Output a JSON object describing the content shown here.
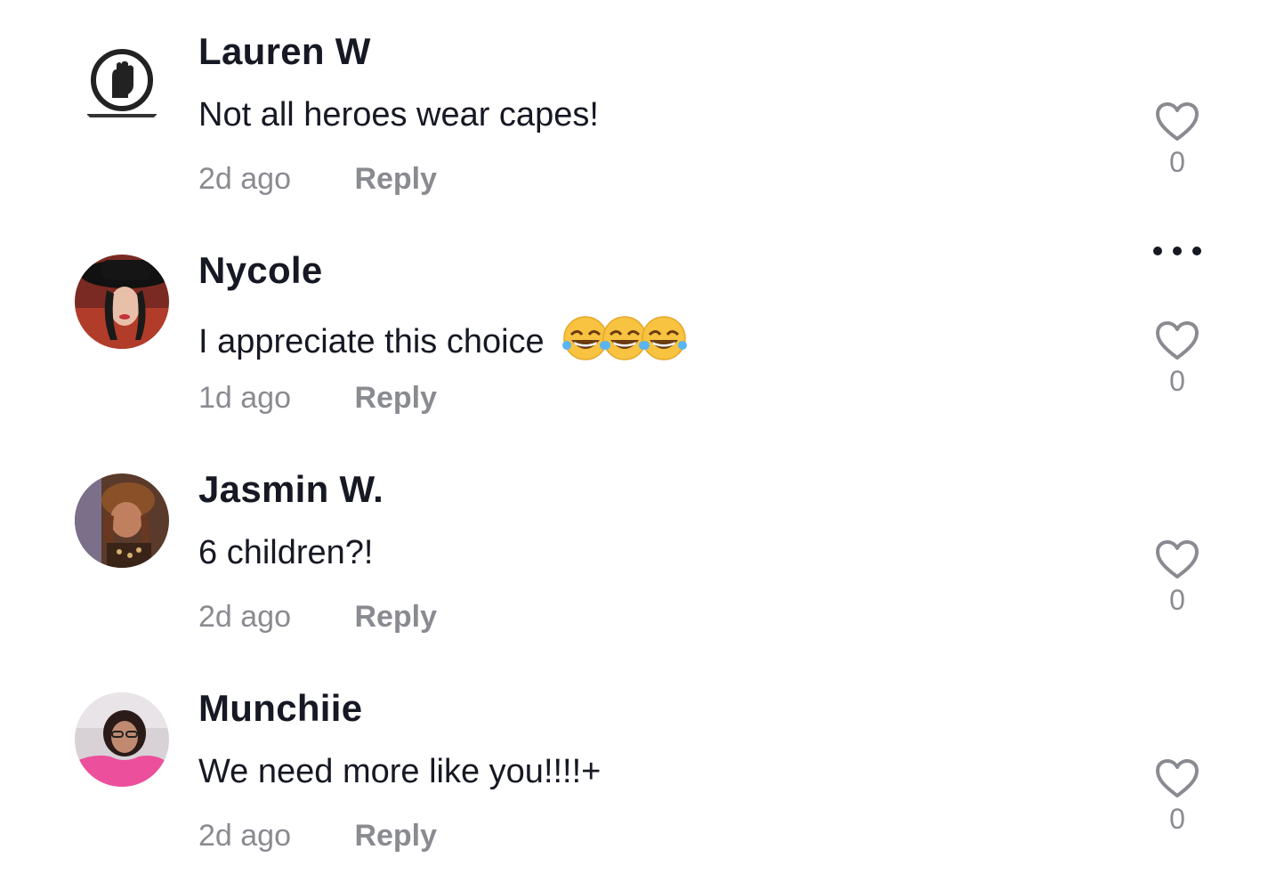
{
  "comments": [
    {
      "username": "Lauren W",
      "text": "Not all heroes wear capes!",
      "time": "2d ago",
      "reply_label": "Reply",
      "likes": "0",
      "avatar": "fist-logo-avatar",
      "emoji": ""
    },
    {
      "username": "Nycole",
      "text": "I appreciate this choice",
      "time": "1d ago",
      "reply_label": "Reply",
      "likes": "0",
      "avatar": "photo-avatar",
      "emoji": "😂😂😂"
    },
    {
      "username": "Jasmin W.",
      "text": "6 children?!",
      "time": "2d ago",
      "reply_label": "Reply",
      "likes": "0",
      "avatar": "photo-avatar",
      "emoji": ""
    },
    {
      "username": "Munchiie",
      "text": "We need more like you!!!!+",
      "time": "2d ago",
      "reply_label": "Reply",
      "likes": "0",
      "avatar": "photo-avatar",
      "emoji": ""
    }
  ],
  "icons": {
    "like": "heart-outline-icon",
    "more": "more-options-icon"
  },
  "colors": {
    "text": "#161823",
    "secondary": "#8a8b91",
    "icon": "#8a8b91"
  }
}
